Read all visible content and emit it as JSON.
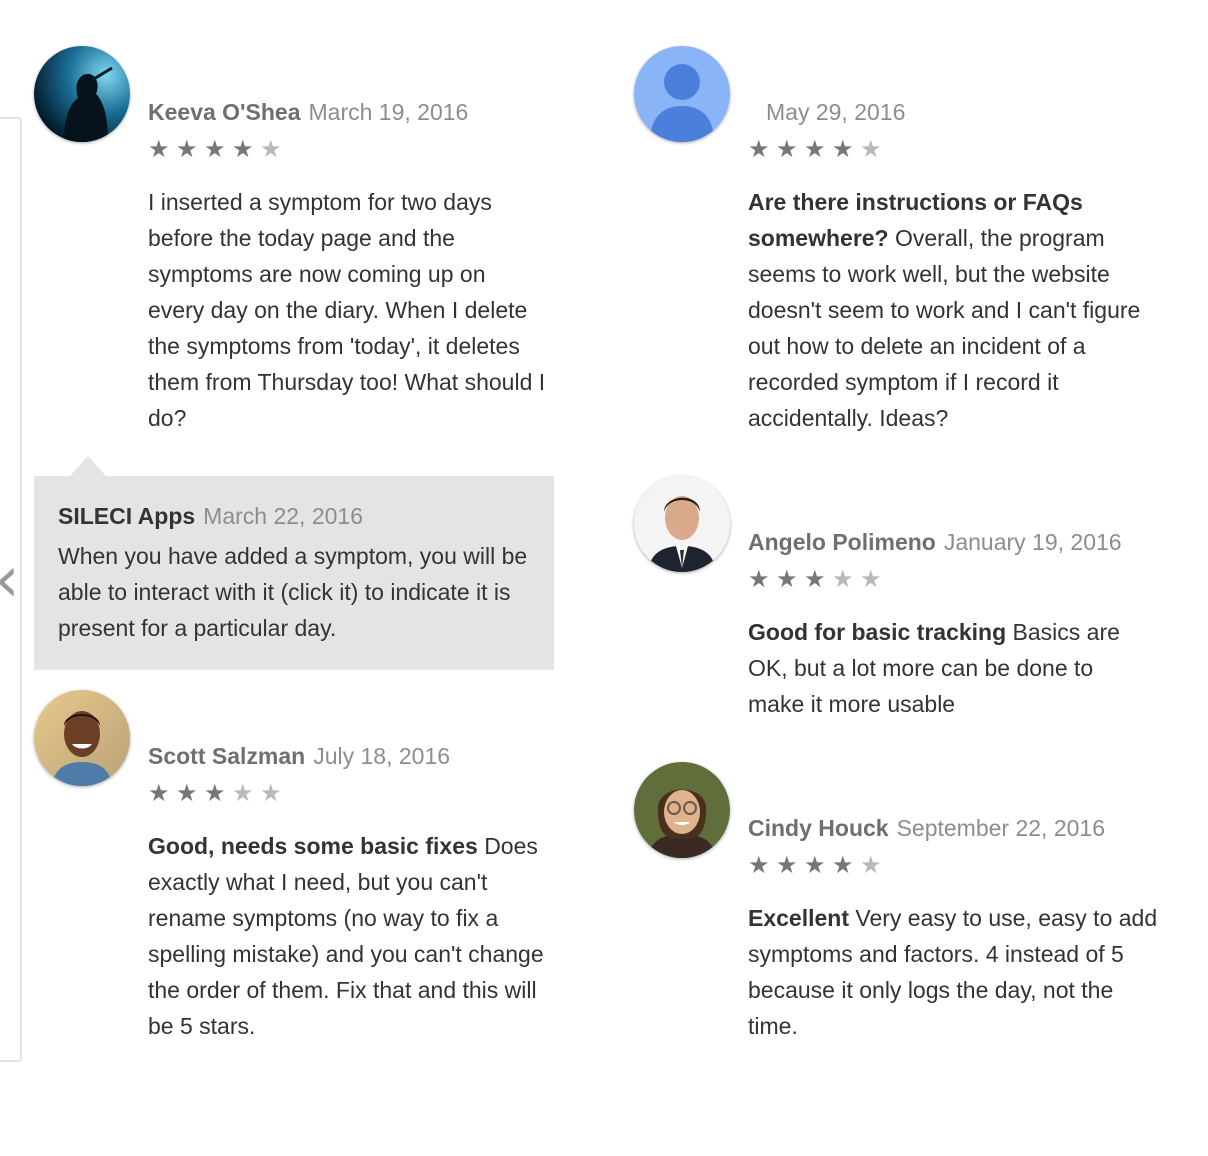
{
  "colors": {
    "star_on": "#777777",
    "star_off": "#b9b9b9",
    "reply_bg": "#e4e4e4",
    "default_avatar_bg": "#8ab4f8",
    "default_avatar_fg": "#4a7fdc"
  },
  "icons": {
    "left_nav": "chevron-left-icon",
    "star": "star-icon"
  },
  "reviews": [
    {
      "author": "Keeva O'Shea",
      "date": "March 19, 2016",
      "rating": 4,
      "title": "",
      "body": "I inserted a symptom for two days before the today page and the symptoms are now coming up on every day on the diary. When I delete the symptoms from 'today', it deletes them from Thursday too! What should I do?",
      "reply": {
        "author": "SILECI Apps",
        "date": "March 22, 2016",
        "body": "When you have added a symptom, you will be able to interact with it (click it) to indicate it is present for a particular day."
      }
    },
    {
      "author": "",
      "date": "May 29, 2016",
      "rating": 4,
      "title": "Are there instructions or FAQs somewhere?",
      "body": "Overall, the program seems to work well, but the website doesn't seem to work and I can't figure out how to delete an incident of a recorded symptom if I record it accidentally. Ideas?"
    },
    {
      "author": "Angelo Polimeno",
      "date": "January 19, 2016",
      "rating": 3,
      "title": "Good for basic tracking",
      "body": "Basics are OK, but a lot more can be done to make it more usable"
    },
    {
      "author": "Scott Salzman",
      "date": "July 18, 2016",
      "rating": 3,
      "title": "Good, needs some basic fixes",
      "body": "Does exactly what I need, but you can't rename symptoms (no way to fix a spelling mistake) and you can't change the order of them. Fix that and this will be 5 stars."
    },
    {
      "author": "Cindy Houck",
      "date": "September 22, 2016",
      "rating": 4,
      "title": "Excellent",
      "body": "Very easy to use, easy to add symptoms and factors. 4 instead of 5 because it only logs the day, not the time."
    }
  ]
}
